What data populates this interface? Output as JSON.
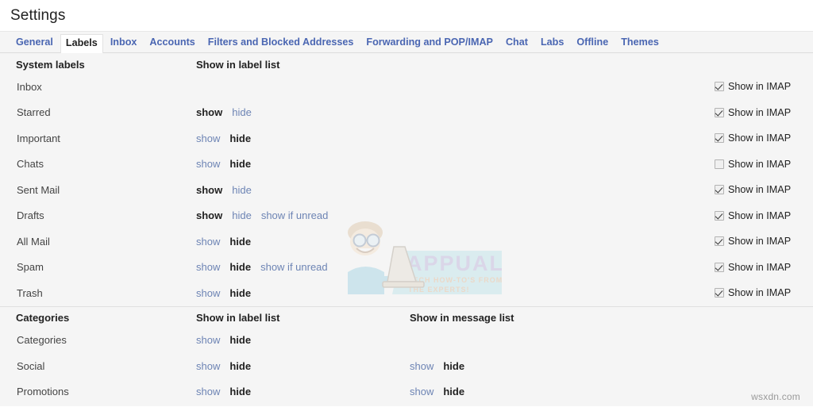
{
  "header": {
    "title": "Settings"
  },
  "tabs": [
    {
      "label": "General",
      "active": false
    },
    {
      "label": "Labels",
      "active": true
    },
    {
      "label": "Inbox",
      "active": false
    },
    {
      "label": "Accounts",
      "active": false
    },
    {
      "label": "Filters and Blocked Addresses",
      "active": false
    },
    {
      "label": "Forwarding and POP/IMAP",
      "active": false
    },
    {
      "label": "Chat",
      "active": false
    },
    {
      "label": "Labs",
      "active": false
    },
    {
      "label": "Offline",
      "active": false
    },
    {
      "label": "Themes",
      "active": false
    }
  ],
  "sections": [
    {
      "title": "System labels",
      "col_label_list_header": "Show in label list",
      "col_message_list_header": "",
      "has_imap": true,
      "imap_label": "Show in IMAP",
      "rows": [
        {
          "name": "Inbox",
          "label_list": [],
          "message_list": [],
          "imap_checked": true
        },
        {
          "name": "Starred",
          "label_list": [
            {
              "text": "show",
              "state": "current"
            },
            {
              "text": "hide",
              "state": "link"
            }
          ],
          "message_list": [],
          "imap_checked": true
        },
        {
          "name": "Important",
          "label_list": [
            {
              "text": "show",
              "state": "link"
            },
            {
              "text": "hide",
              "state": "current"
            }
          ],
          "message_list": [],
          "imap_checked": true
        },
        {
          "name": "Chats",
          "label_list": [
            {
              "text": "show",
              "state": "link"
            },
            {
              "text": "hide",
              "state": "current"
            }
          ],
          "message_list": [],
          "imap_checked": false
        },
        {
          "name": "Sent Mail",
          "label_list": [
            {
              "text": "show",
              "state": "current"
            },
            {
              "text": "hide",
              "state": "link"
            }
          ],
          "message_list": [],
          "imap_checked": true
        },
        {
          "name": "Drafts",
          "label_list": [
            {
              "text": "show",
              "state": "current"
            },
            {
              "text": "hide",
              "state": "link"
            },
            {
              "text": "show if unread",
              "state": "link"
            }
          ],
          "message_list": [],
          "imap_checked": true
        },
        {
          "name": "All Mail",
          "label_list": [
            {
              "text": "show",
              "state": "link"
            },
            {
              "text": "hide",
              "state": "current"
            }
          ],
          "message_list": [],
          "imap_checked": true
        },
        {
          "name": "Spam",
          "label_list": [
            {
              "text": "show",
              "state": "link"
            },
            {
              "text": "hide",
              "state": "current"
            },
            {
              "text": "show if unread",
              "state": "link"
            }
          ],
          "message_list": [],
          "imap_checked": true
        },
        {
          "name": "Trash",
          "label_list": [
            {
              "text": "show",
              "state": "link"
            },
            {
              "text": "hide",
              "state": "current"
            }
          ],
          "message_list": [],
          "imap_checked": true
        }
      ]
    },
    {
      "title": "Categories",
      "col_label_list_header": "Show in label list",
      "col_message_list_header": "Show in message list",
      "has_imap": false,
      "imap_label": "",
      "rows": [
        {
          "name": "Categories",
          "label_list": [
            {
              "text": "show",
              "state": "link"
            },
            {
              "text": "hide",
              "state": "current"
            }
          ],
          "message_list": [],
          "imap_checked": null
        },
        {
          "name": "Social",
          "label_list": [
            {
              "text": "show",
              "state": "link"
            },
            {
              "text": "hide",
              "state": "current"
            }
          ],
          "message_list": [
            {
              "text": "show",
              "state": "link"
            },
            {
              "text": "hide",
              "state": "current"
            }
          ],
          "imap_checked": null
        },
        {
          "name": "Promotions",
          "label_list": [
            {
              "text": "show",
              "state": "link"
            },
            {
              "text": "hide",
              "state": "current"
            }
          ],
          "message_list": [
            {
              "text": "show",
              "state": "link"
            },
            {
              "text": "hide",
              "state": "current"
            }
          ],
          "imap_checked": null
        }
      ]
    }
  ],
  "watermarks": {
    "brand": "APPUALS",
    "tagline_line1": "TECH HOW-TO'S FROM",
    "tagline_line2": "THE EXPERTS!",
    "corner": "wsxdn.com"
  },
  "colors": {
    "tab_link": "#4a66b2",
    "option_link": "#6d84b4",
    "panel_bg": "#f5f5f5",
    "text": "#222222"
  }
}
